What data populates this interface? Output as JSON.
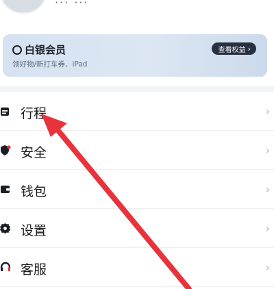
{
  "header": {
    "name": "···  ···"
  },
  "member_card": {
    "title": "白银会员",
    "subtitle": "领好物/新打车券、iPad",
    "benefits_label": "查看权益",
    "benefits_chevron": "›"
  },
  "menu": {
    "items": [
      {
        "label": "行程",
        "icon": "calendar-icon"
      },
      {
        "label": "安全",
        "icon": "shield-icon"
      },
      {
        "label": "钱包",
        "icon": "wallet-icon"
      },
      {
        "label": "设置",
        "icon": "gear-icon"
      },
      {
        "label": "客服",
        "icon": "headset-icon"
      }
    ],
    "chevron": "›"
  },
  "colors": {
    "accent_red": "#e8333c",
    "dark": "#1b1f26"
  }
}
